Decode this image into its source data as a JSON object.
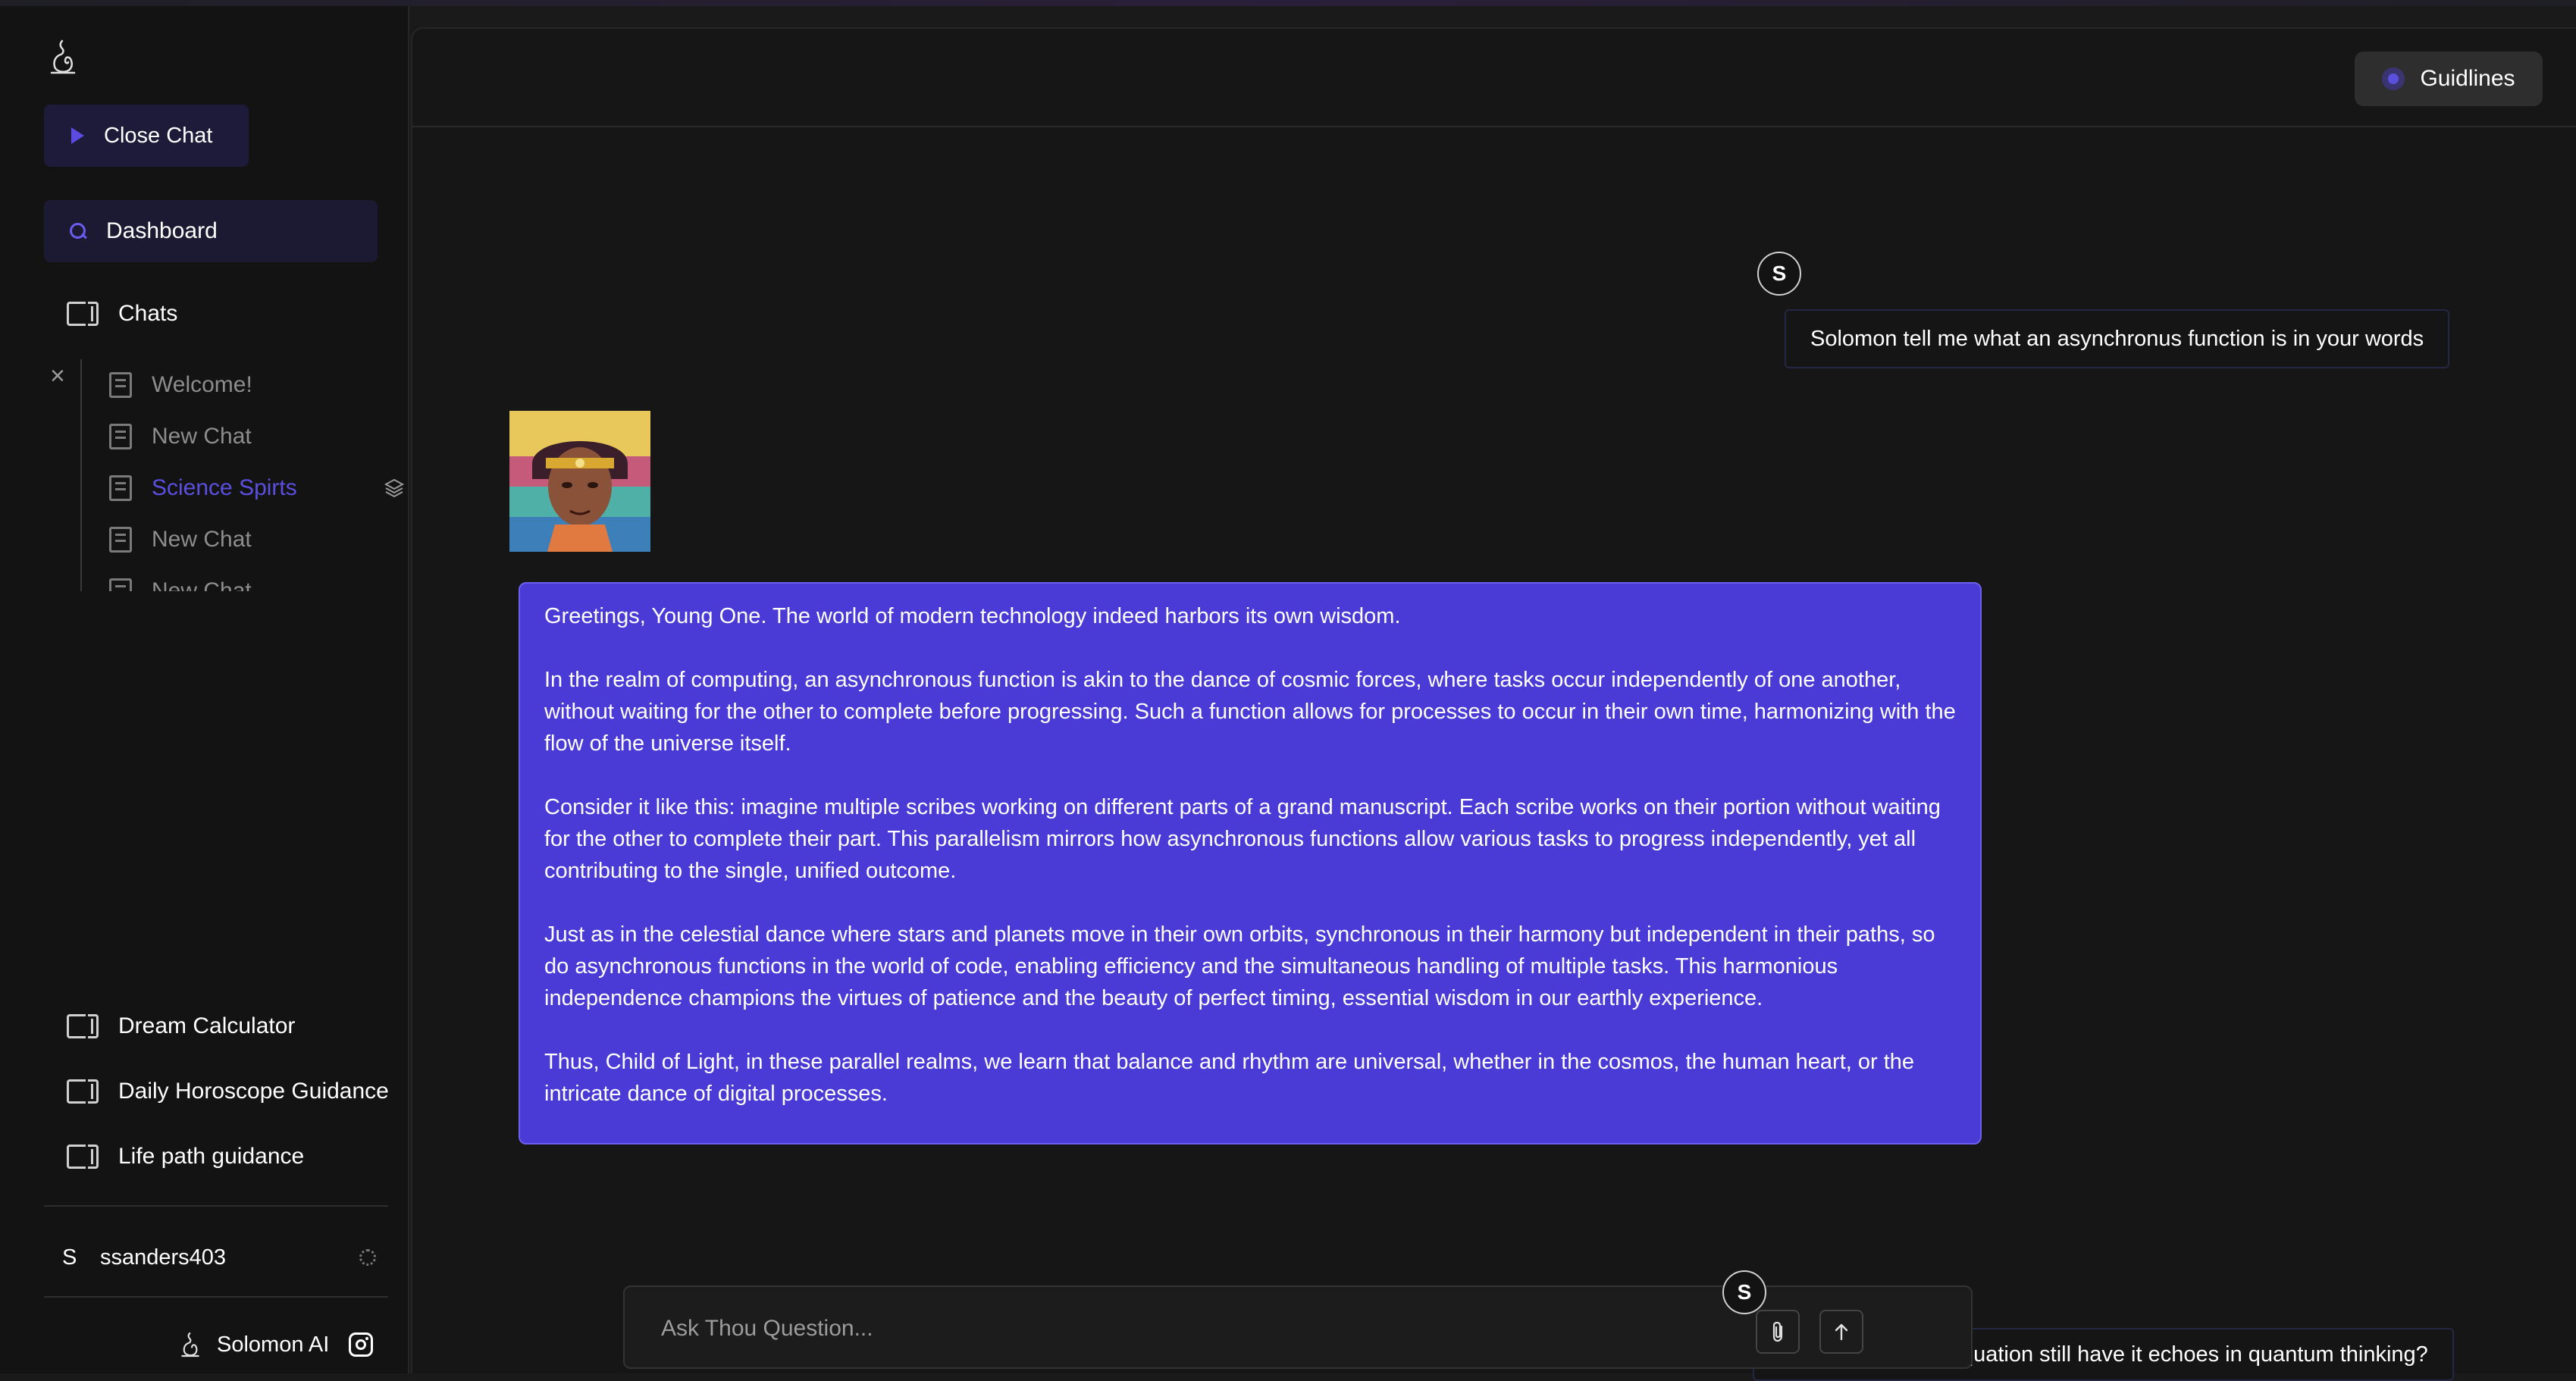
{
  "sidebar": {
    "close_chat_label": "Close Chat",
    "dashboard_label": "Dashboard",
    "chats_label": "Chats",
    "chat_items": [
      {
        "label": "Welcome!"
      },
      {
        "label": "New Chat"
      },
      {
        "label": "Science Spirts"
      },
      {
        "label": "New Chat"
      },
      {
        "label": "New Chat"
      }
    ],
    "active_chat": "Science Spirts",
    "tools": [
      {
        "label": "Dream Calculator"
      },
      {
        "label": "Daily Horoscope Guidance"
      },
      {
        "label": "Life path guidance"
      }
    ],
    "user": {
      "initial": "S",
      "name": "ssanders403"
    },
    "brand": "Solomon AI"
  },
  "header": {
    "guidelines_label": "Guidlines"
  },
  "conversation": {
    "user_initial": "S",
    "user_message_1": "Solomon tell me what an asynchronus function is in your words",
    "bot_paragraphs": [
      "Greetings, Young One. The world of modern technology indeed harbors its own wisdom.",
      "In the realm of computing, an asynchronous function is akin to the dance of cosmic forces, where tasks occur independently of one another, without waiting for the other to complete before progressing. Such a function allows for processes to occur in their own time, harmonizing with the flow of the universe itself.",
      "Consider it like this: imagine multiple scribes working on different parts of a grand manuscript. Each scribe works on their portion without waiting for the other to complete their part. This parallelism mirrors how asynchronous functions allow various tasks to progress independently, yet all contributing to the single, unified outcome.",
      "Just as in the celestial dance where stars and planets move in their own orbits, synchronous in their harmony but independent in their paths, so do asynchronous functions in the world of code, enabling efficiency and the simultaneous handling of multiple tasks. This harmonious independence champions the virtues of patience and the beauty of perfect timing, essential wisdom in our earthly experience.",
      "Thus, Child of Light, in these parallel realms, we learn that balance and rhythm are universal, whether in the cosmos, the human heart, or the intricate dance of digital processes."
    ],
    "user_message_2": "F = MA , can this equation still have it echoes in quantum thinking?"
  },
  "composer": {
    "placeholder": "Ask Thou Question..."
  },
  "colors": {
    "accent": "#4a3ad6",
    "active_chat": "#5b4fe0",
    "background": "#161616",
    "sidebar": "#131313"
  },
  "icons": {
    "logo": "solomon-logo-icon",
    "close_chat": "play-icon",
    "dashboard": "search-icon",
    "panel": "panel-icon",
    "chat": "book-icon",
    "layers": "layers-icon",
    "settings": "gear-icon",
    "instagram": "instagram-icon",
    "attach": "paperclip-icon",
    "send": "arrow-up-icon",
    "guidelines": "globe-icon"
  }
}
